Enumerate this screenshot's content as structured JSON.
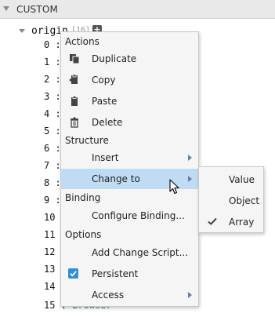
{
  "section": {
    "title": "CUSTOM"
  },
  "tree": {
    "root_name": "origin",
    "root_count": "[16]",
    "add_symbol": "+",
    "rows": [
      {
        "index": "0",
        "sep": ":",
        "value": ""
      },
      {
        "index": "1",
        "sep": ":",
        "value": ""
      },
      {
        "index": "2",
        "sep": ":",
        "value": ""
      },
      {
        "index": "3",
        "sep": ":",
        "value": ""
      },
      {
        "index": "4",
        "sep": ":",
        "value": ""
      },
      {
        "index": "5",
        "sep": ":",
        "value": ""
      },
      {
        "index": "6",
        "sep": ":",
        "value": ""
      },
      {
        "index": "7",
        "sep": ":",
        "value": ""
      },
      {
        "index": "8",
        "sep": ":",
        "value": ""
      },
      {
        "index": "9",
        "sep": ":",
        "value": ""
      },
      {
        "index": "10",
        "sep": "",
        "value": ""
      },
      {
        "index": "11",
        "sep": "",
        "value": ""
      },
      {
        "index": "12",
        "sep": "",
        "value": ""
      },
      {
        "index": "13",
        "sep": "",
        "value": ""
      },
      {
        "index": "14",
        "sep": "",
        "value": ""
      },
      {
        "index": "15",
        "sep": ":",
        "value": "Browser"
      }
    ]
  },
  "menu": {
    "sections": {
      "actions": "Actions",
      "structure": "Structure",
      "binding": "Binding",
      "options": "Options"
    },
    "items": {
      "duplicate": "Duplicate",
      "copy": "Copy",
      "paste": "Paste",
      "delete": "Delete",
      "insert": "Insert",
      "change_to": "Change to",
      "configure_binding": "Configure Binding...",
      "add_change_script": "Add Change Script...",
      "persistent": "Persistent",
      "access": "Access"
    },
    "persistent_checked": true,
    "active_item": "change_to"
  },
  "submenu": {
    "items": [
      "Value",
      "Object",
      "Array"
    ],
    "checked": "Array"
  },
  "colors": {
    "highlight": "#bfdcf4",
    "check_blue": "#2d8fdd",
    "value_green": "#2e8b57",
    "arrow": "#6a7fa0"
  }
}
